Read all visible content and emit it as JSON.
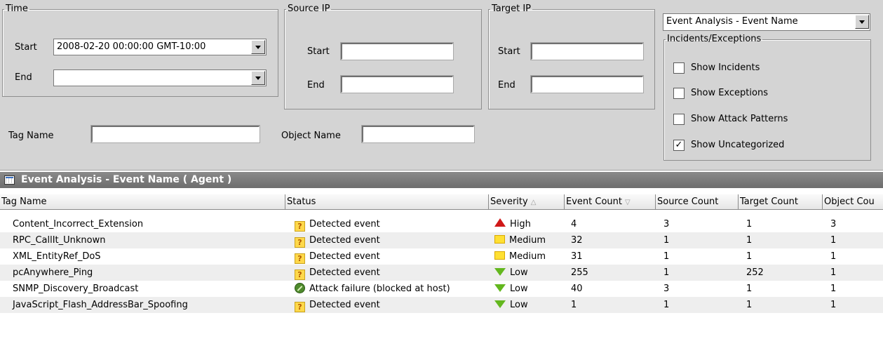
{
  "filters": {
    "time": {
      "legend": "Time",
      "start_label": "Start",
      "start_value": "2008-02-20 00:00:00 GMT-10:00",
      "end_label": "End",
      "end_value": ""
    },
    "source_ip": {
      "legend": "Source IP",
      "start_label": "Start",
      "start_value": "",
      "end_label": "End",
      "end_value": ""
    },
    "target_ip": {
      "legend": "Target IP",
      "start_label": "Start",
      "start_value": "",
      "end_label": "End",
      "end_value": ""
    },
    "tag_name_label": "Tag Name",
    "tag_name_value": "",
    "object_name_label": "Object Name",
    "object_name_value": "",
    "view_select": "Event Analysis - Event Name",
    "incidents": {
      "legend": "Incidents/Exceptions",
      "options": [
        {
          "label": "Show Incidents",
          "checked": false
        },
        {
          "label": "Show Exceptions",
          "checked": false
        },
        {
          "label": "Show Attack Patterns",
          "checked": false
        },
        {
          "label": "Show Uncategorized",
          "checked": true
        }
      ]
    }
  },
  "panel_title": "Event Analysis - Event Name ( Agent )",
  "table": {
    "columns": [
      {
        "label": "Tag Name",
        "sort": ""
      },
      {
        "label": "Status",
        "sort": ""
      },
      {
        "label": "Severity",
        "sort": "asc"
      },
      {
        "label": "Event Count",
        "sort": "desc"
      },
      {
        "label": "Source Count",
        "sort": ""
      },
      {
        "label": "Target Count",
        "sort": ""
      },
      {
        "label": "Object Cou",
        "sort": ""
      }
    ],
    "rows": [
      {
        "tag": "Content_Incorrect_Extension",
        "status": "Detected event",
        "status_icon": "question-icon",
        "severity": "High",
        "severity_icon": "high-severity-icon",
        "event_count": "4",
        "source_count": "3",
        "target_count": "1",
        "object_count": "3"
      },
      {
        "tag": "RPC_CallIt_Unknown",
        "status": "Detected event",
        "status_icon": "question-icon",
        "severity": "Medium",
        "severity_icon": "medium-severity-icon",
        "event_count": "32",
        "source_count": "1",
        "target_count": "1",
        "object_count": "1"
      },
      {
        "tag": "XML_EntityRef_DoS",
        "status": "Detected event",
        "status_icon": "question-icon",
        "severity": "Medium",
        "severity_icon": "medium-severity-icon",
        "event_count": "31",
        "source_count": "1",
        "target_count": "1",
        "object_count": "1"
      },
      {
        "tag": "pcAnywhere_Ping",
        "status": "Detected event",
        "status_icon": "question-icon",
        "severity": "Low",
        "severity_icon": "low-severity-icon",
        "event_count": "255",
        "source_count": "1",
        "target_count": "252",
        "object_count": "1"
      },
      {
        "tag": "SNMP_Discovery_Broadcast",
        "status": "Attack failure (blocked at host)",
        "status_icon": "blocked-icon",
        "severity": "Low",
        "severity_icon": "low-severity-icon",
        "event_count": "40",
        "source_count": "3",
        "target_count": "1",
        "object_count": "1"
      },
      {
        "tag": "JavaScript_Flash_AddressBar_Spoofing",
        "status": "Detected event",
        "status_icon": "question-icon",
        "severity": "Low",
        "severity_icon": "low-severity-icon",
        "event_count": "1",
        "source_count": "1",
        "target_count": "1",
        "object_count": "1"
      }
    ]
  }
}
